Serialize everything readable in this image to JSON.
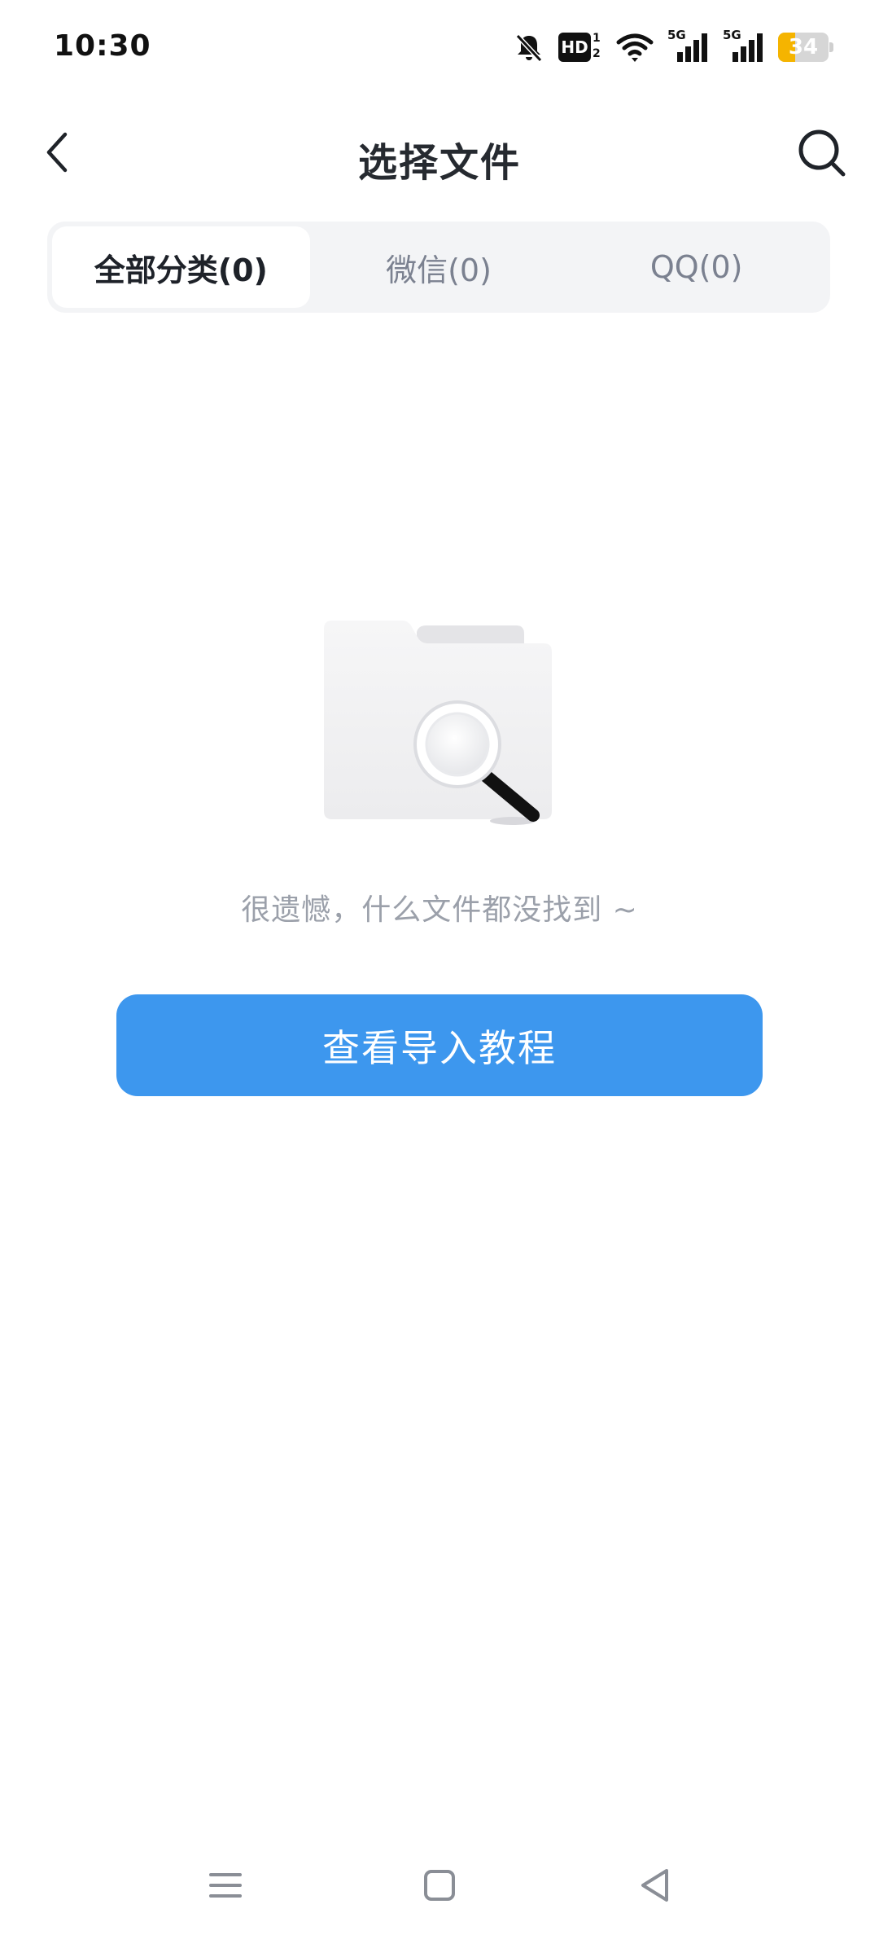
{
  "status_bar": {
    "time": "10:30",
    "hd_label": "HD",
    "hd_sub": [
      "1",
      "2"
    ],
    "network_label": "5G",
    "battery_level": 34,
    "battery_text": "34",
    "battery_color": "#f5b400",
    "icons": [
      "bell-off-icon",
      "hd-icon",
      "wifi-icon",
      "signal-5g-icon",
      "signal-5g-icon",
      "battery-icon"
    ]
  },
  "header": {
    "title": "选择文件",
    "back_icon": "chevron-left-icon",
    "search_icon": "search-icon"
  },
  "tabs": [
    {
      "label": "全部分类(0)",
      "active": true
    },
    {
      "label": "微信(0)",
      "active": false
    },
    {
      "label": "QQ(0)",
      "active": false
    }
  ],
  "empty_state": {
    "illustration": "folder-search-illustration",
    "message": "很遗憾，什么文件都没找到 ~",
    "button_label": "查看导入教程",
    "button_color": "#3d97ee"
  },
  "nav_bar": {
    "icons": [
      "menu-icon",
      "home-icon",
      "back-triangle-icon"
    ]
  }
}
